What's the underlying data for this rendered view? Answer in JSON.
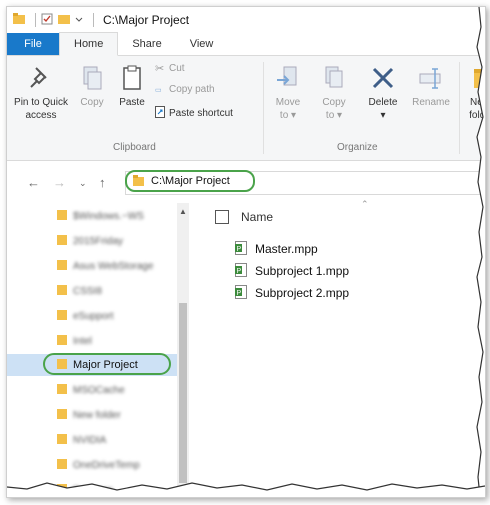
{
  "window": {
    "title": "C:\\Major Project"
  },
  "tabs": [
    {
      "label": "File"
    },
    {
      "label": "Home"
    },
    {
      "label": "Share"
    },
    {
      "label": "View"
    }
  ],
  "ribbon": {
    "clipboard": {
      "group_label": "Clipboard",
      "pin": "Pin to Quick access",
      "pin_line1": "Pin to Quick",
      "pin_line2": "access",
      "copy": "Copy",
      "paste": "Paste",
      "cut": "Cut",
      "copy_path": "Copy path",
      "paste_shortcut": "Paste shortcut"
    },
    "organize": {
      "group_label": "Organize",
      "move_line1": "Move",
      "move_line2": "to ▾",
      "copy_line1": "Copy",
      "copy_line2": "to ▾",
      "delete": "Delete",
      "delete_arrow": "▾",
      "rename": "Rename"
    },
    "new": {
      "line1": "New",
      "line2": "folde"
    }
  },
  "address": {
    "path": "C:\\Major Project"
  },
  "nav_pane": {
    "items": [
      {
        "label": "$Windows.~WS"
      },
      {
        "label": "2015Friday"
      },
      {
        "label": "Asus WebStorage"
      },
      {
        "label": "CSSI8"
      },
      {
        "label": "eSupport"
      },
      {
        "label": "Intel"
      },
      {
        "label": "Major Project",
        "selected": true
      },
      {
        "label": "MSOCache"
      },
      {
        "label": "New folder"
      },
      {
        "label": "NVIDIA"
      },
      {
        "label": "OneDriveTemp"
      },
      {
        "label": "PerfLogs"
      }
    ]
  },
  "content": {
    "column_name": "Name",
    "files": [
      {
        "name": "Master.mpp",
        "icon": "project-file-icon"
      },
      {
        "name": "Subproject 1.mpp",
        "icon": "project-file-icon"
      },
      {
        "name": "Subproject 2.mpp",
        "icon": "project-file-icon"
      }
    ]
  },
  "colors": {
    "file_tab": "#1979ca",
    "highlight_ring": "#4aa34a",
    "folder": "#f3c04a",
    "project_green": "#3c8b3c"
  }
}
